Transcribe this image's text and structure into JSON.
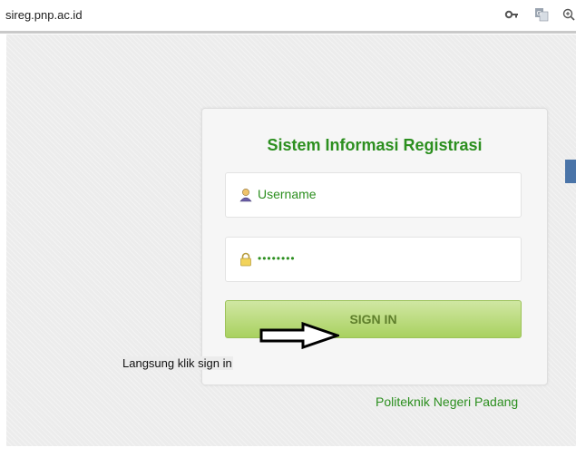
{
  "browser": {
    "url": "sireg.pnp.ac.id",
    "icons": [
      "key-icon",
      "translate-icon",
      "zoom-icon"
    ]
  },
  "login": {
    "title": "Sistem Informasi Registrasi",
    "username_placeholder": "Username",
    "password_value": "••••••••",
    "signin_label": "SIGN IN"
  },
  "annotation": {
    "text": "Langsung klik sign in"
  },
  "footer": {
    "institution": "Politeknik Negeri Padang"
  },
  "colors": {
    "brand_green": "#2c8f1f",
    "button_green_top": "#d0e7a3",
    "button_green_bottom": "#a9d160"
  }
}
